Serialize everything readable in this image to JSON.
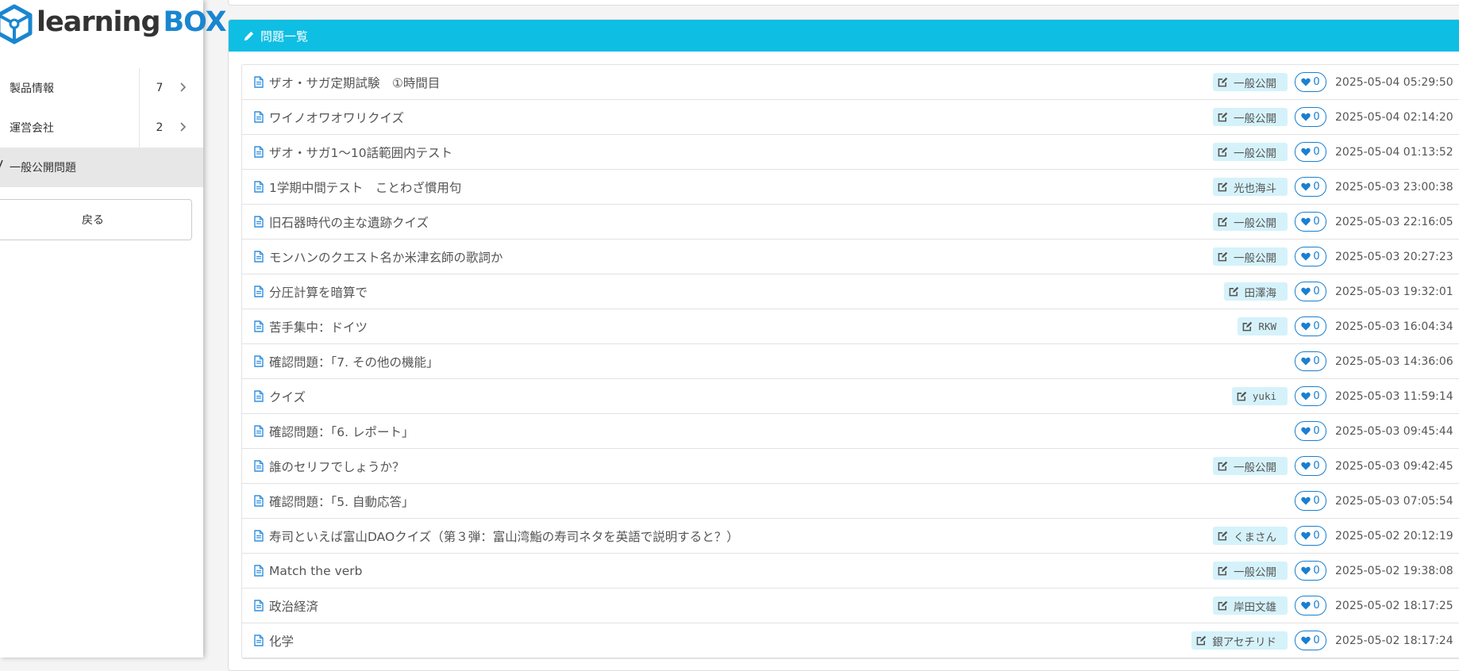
{
  "brand": {
    "name_part1": "learning",
    "name_part2": "BOX"
  },
  "sidebar": {
    "items": [
      {
        "label": "製品情報",
        "count": "7"
      },
      {
        "label": "運営会社",
        "count": "2"
      }
    ],
    "active_item": {
      "label": "一般公開問題"
    },
    "back_label": "戻る"
  },
  "panel": {
    "title": "問題一覧"
  },
  "questions": [
    {
      "title": "ザオ・サガ定期試験　①時間目",
      "author": "一般公開",
      "likes": "0",
      "date": "2025-05-04 05:29:50"
    },
    {
      "title": "ワイノオワオワリクイズ",
      "author": "一般公開",
      "likes": "0",
      "date": "2025-05-04 02:14:20"
    },
    {
      "title": "ザオ・サガ1〜10話範囲内テスト",
      "author": "一般公開",
      "likes": "0",
      "date": "2025-05-04 01:13:52"
    },
    {
      "title": "1学期中間テスト　ことわざ慣用句",
      "author": "光也海斗",
      "likes": "0",
      "date": "2025-05-03 23:00:38"
    },
    {
      "title": "旧石器時代の主な遺跡クイズ",
      "author": "一般公開",
      "likes": "0",
      "date": "2025-05-03 22:16:05"
    },
    {
      "title": "モンハンのクエスト名か米津玄師の歌詞か",
      "author": "一般公開",
      "likes": "0",
      "date": "2025-05-03 20:27:23"
    },
    {
      "title": "分圧計算を暗算で",
      "author": "田澤海",
      "likes": "0",
      "date": "2025-05-03 19:32:01"
    },
    {
      "title": "苦手集中：ドイツ",
      "author": "RKW",
      "likes": "0",
      "date": "2025-05-03 16:04:34"
    },
    {
      "title": "確認問題：「7. その他の機能」",
      "author": "",
      "likes": "0",
      "date": "2025-05-03 14:36:06"
    },
    {
      "title": "クイズ",
      "author": "yuki",
      "likes": "0",
      "date": "2025-05-03 11:59:14"
    },
    {
      "title": "確認問題：「6. レポート」",
      "author": "",
      "likes": "0",
      "date": "2025-05-03 09:45:44"
    },
    {
      "title": "誰のセリフでしょうか？",
      "author": "一般公開",
      "likes": "0",
      "date": "2025-05-03 09:42:45"
    },
    {
      "title": "確認問題：「5. 自動応答」",
      "author": "",
      "likes": "0",
      "date": "2025-05-03 07:05:54"
    },
    {
      "title": "寿司といえば富山DAOクイズ（第３弾：富山湾鮨の寿司ネタを英語で説明すると？）",
      "author": "くまさん",
      "likes": "0",
      "date": "2025-05-02 20:12:19"
    },
    {
      "title": "Match the verb",
      "author": "一般公開",
      "likes": "0",
      "date": "2025-05-02 19:38:08"
    },
    {
      "title": "政治経済",
      "author": "岸田文雄",
      "likes": "0",
      "date": "2025-05-02 18:17:25"
    },
    {
      "title": "化学",
      "author": "銀アセチリド",
      "likes": "0",
      "date": "2025-05-02 18:17:24"
    }
  ],
  "colors": {
    "header": "#0fbee3",
    "tag_bg": "#d5f2fa",
    "like": "#1a7fd0",
    "doc_icon": "#2f8fe0"
  },
  "icons": {
    "doc": "file-text-icon",
    "tag": "edit-icon",
    "like": "heart-icon",
    "header": "pencil-icon",
    "nav": "chevron-right-icon"
  }
}
